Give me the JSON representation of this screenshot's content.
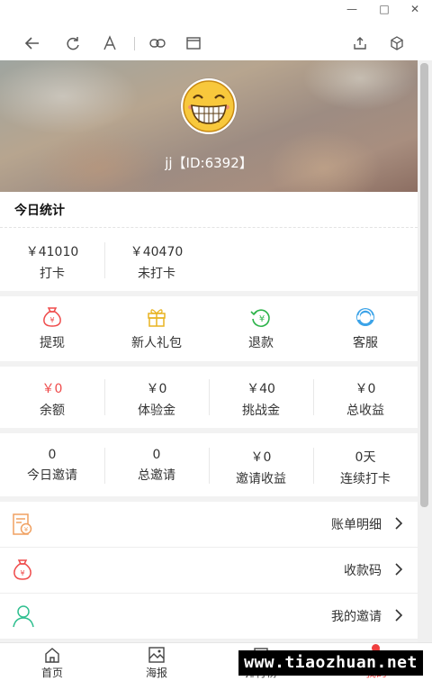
{
  "window": {
    "minimize_glyph": "—",
    "maximize_glyph": "□",
    "close_glyph": "✕"
  },
  "toolbar": {
    "icons": [
      "back-arrow-icon",
      "refresh-icon",
      "font-icon",
      "link-icon",
      "window-icon",
      "share-icon",
      "cube-icon"
    ]
  },
  "profile": {
    "name": "jj【ID:6392】"
  },
  "today_stats": {
    "title": "今日统计",
    "items": [
      {
        "value": "￥41010",
        "label": "打卡"
      },
      {
        "value": "￥40470",
        "label": "未打卡"
      }
    ]
  },
  "actions": [
    {
      "label": "提现",
      "icon": "money-bag-icon",
      "color": "#ef4b4b"
    },
    {
      "label": "新人礼包",
      "icon": "gift-icon",
      "color": "#e8b321"
    },
    {
      "label": "退款",
      "icon": "refund-icon",
      "color": "#2db34a"
    },
    {
      "label": "客服",
      "icon": "customer-service-icon",
      "color": "#3ba3e8"
    }
  ],
  "balances": [
    {
      "value": "￥0",
      "label": "余额",
      "value_color": "#ef4b4b"
    },
    {
      "value": "￥0",
      "label": "体验金",
      "value_color": "#333333"
    },
    {
      "value": "￥40",
      "label": "挑战金",
      "value_color": "#333333"
    },
    {
      "value": "￥0",
      "label": "总收益",
      "value_color": "#333333"
    }
  ],
  "invites": [
    {
      "value": "0",
      "label": "今日邀请"
    },
    {
      "value": "0",
      "label": "总邀请"
    },
    {
      "value": "￥0",
      "label": "邀请收益"
    },
    {
      "value": "0天",
      "label": "连续打卡"
    }
  ],
  "menu": [
    {
      "label": "账单明细",
      "icon": "bill-icon",
      "color": "#f0a060"
    },
    {
      "label": "收款码",
      "icon": "money-bag-icon",
      "color": "#ef4b4b"
    },
    {
      "label": "我的邀请",
      "icon": "user-icon",
      "color": "#2fbf8f"
    }
  ],
  "bottom_nav": [
    {
      "label": "首页",
      "icon": "home-icon"
    },
    {
      "label": "海报",
      "icon": "poster-icon"
    },
    {
      "label": "排行榜",
      "icon": "ranking-icon"
    },
    {
      "label": "我的",
      "icon": "profile-icon"
    }
  ],
  "watermark": "www.tiaozhuan.net"
}
